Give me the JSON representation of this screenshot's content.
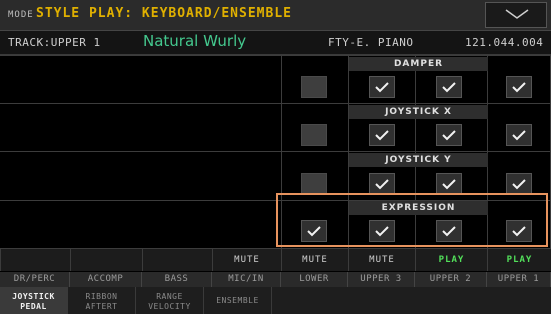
{
  "mode": {
    "label": "MODE",
    "title": "STYLE PLAY: KEYBOARD/ENSEMBLE"
  },
  "track": {
    "label": "TRACK:UPPER 1",
    "sound_name": "Natural Wurly",
    "bank": "FTY-E. PIANO",
    "program": "121.044.004"
  },
  "sections": [
    {
      "label": "DAMPER",
      "checks": [
        false,
        true,
        true,
        true
      ]
    },
    {
      "label": "JOYSTICK X",
      "checks": [
        false,
        true,
        true,
        true
      ]
    },
    {
      "label": "JOYSTICK Y",
      "checks": [
        false,
        true,
        true,
        true
      ]
    },
    {
      "label": "EXPRESSION",
      "checks": [
        true,
        true,
        true,
        true
      ]
    }
  ],
  "mute_row": [
    {
      "label": ""
    },
    {
      "label": ""
    },
    {
      "label": ""
    },
    {
      "label": "MUTE",
      "state": "mute"
    },
    {
      "label": "MUTE",
      "state": "mute"
    },
    {
      "label": "MUTE",
      "state": "mute"
    },
    {
      "label": "PLAY",
      "state": "play"
    },
    {
      "label": "PLAY",
      "state": "play"
    }
  ],
  "channels": [
    "DR/PERC",
    "ACCOMP",
    "BASS",
    "MIC/IN",
    "LOWER",
    "UPPER 3",
    "UPPER 2",
    "UPPER 1"
  ],
  "tabs": [
    {
      "line1": "JOYSTICK",
      "line2": "PEDAL",
      "active": true
    },
    {
      "line1": "RIBBON",
      "line2": "AFTERT",
      "active": false
    },
    {
      "line1": "RANGE",
      "line2": "VELOCITY",
      "active": false
    },
    {
      "line1": "ENSEMBLE",
      "line2": "",
      "active": false
    }
  ],
  "colors": {
    "mode_title": "#e0b000",
    "sound_name": "#44c88e",
    "play": "#52e05a",
    "highlight": "#e7935e"
  }
}
